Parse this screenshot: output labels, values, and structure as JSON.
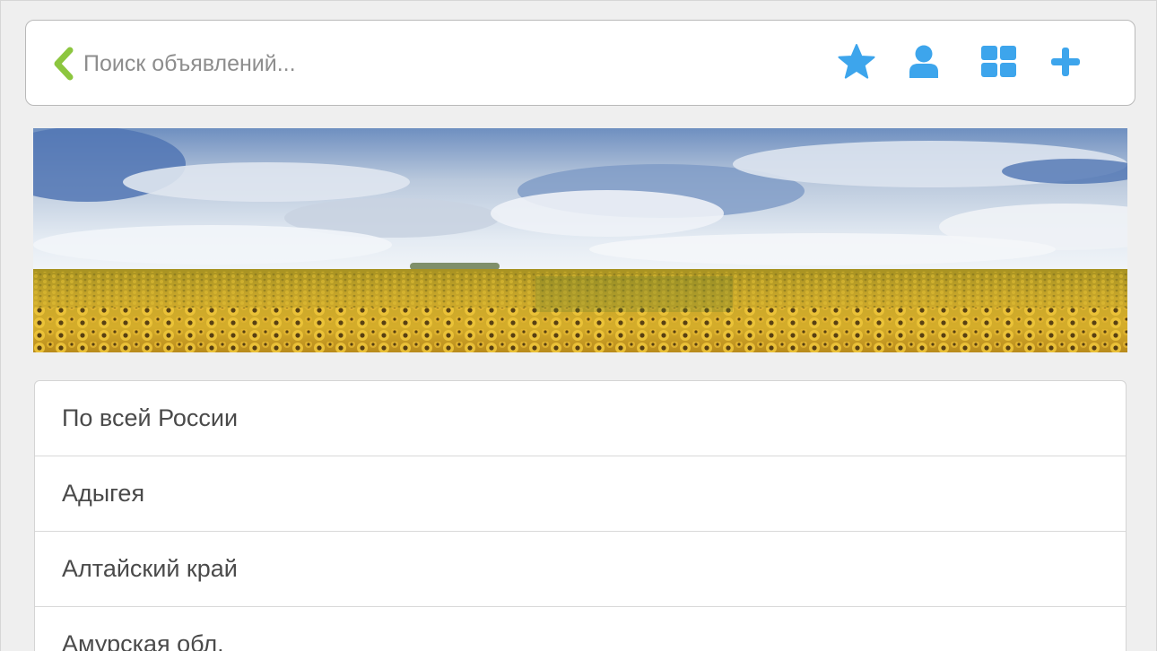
{
  "header": {
    "back_icon": "chevron-left-icon",
    "search_placeholder": "Поиск объявлений...",
    "search_value": "",
    "icons": [
      "star-icon",
      "user-icon",
      "grid-icon",
      "plus-icon"
    ]
  },
  "colors": {
    "accent_green": "#8cc63f",
    "accent_blue": "#3da5ec",
    "background": "#efefef"
  },
  "banner": {
    "image": "sunflower-field-banner"
  },
  "regions": [
    {
      "label": "По всей России"
    },
    {
      "label": "Адыгея"
    },
    {
      "label": "Алтайский край"
    },
    {
      "label": "Амурская обл."
    }
  ]
}
